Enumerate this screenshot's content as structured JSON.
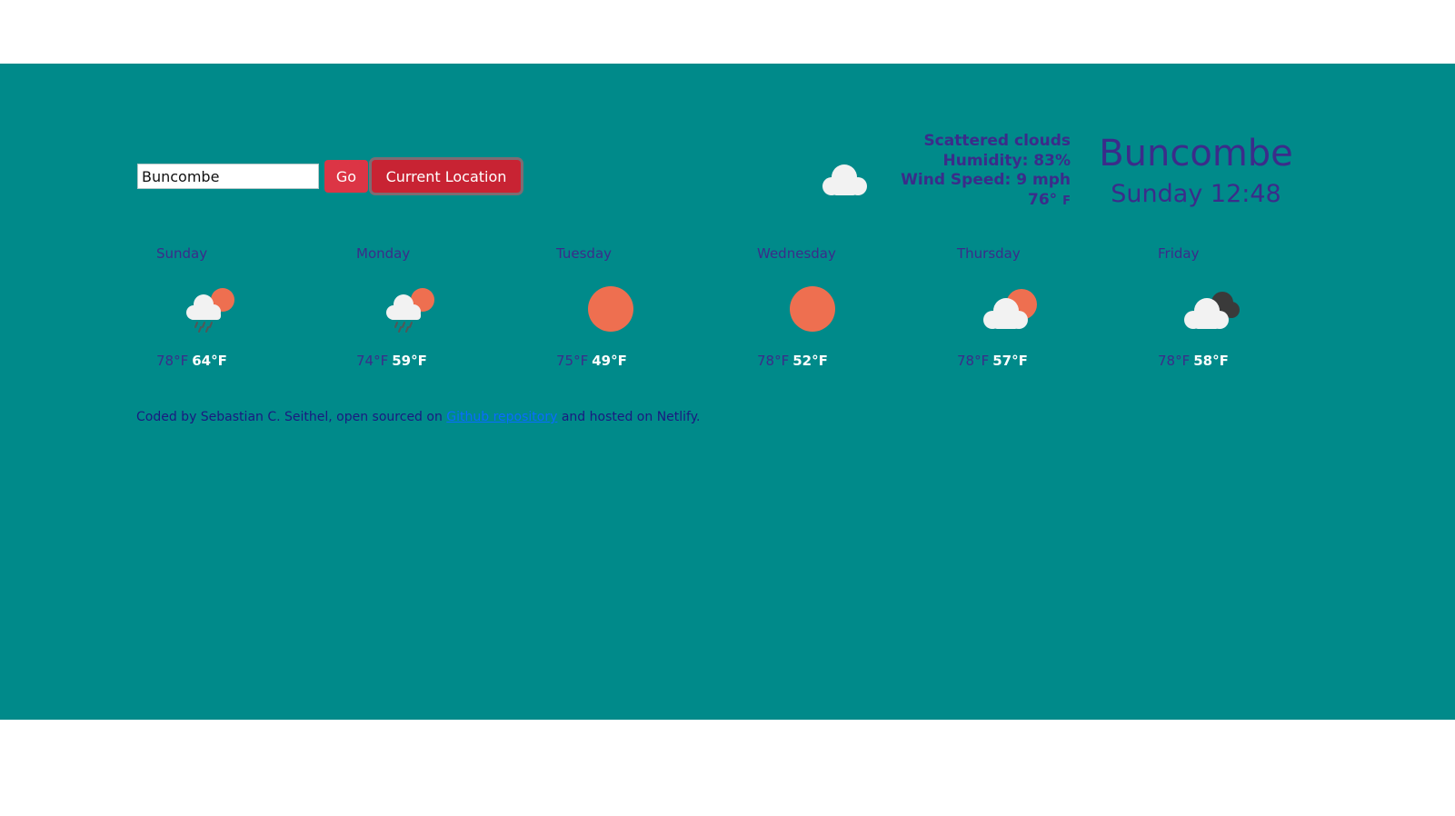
{
  "search": {
    "value": "Buncombe",
    "go_label": "Go",
    "location_label": "Current Location"
  },
  "current": {
    "icon": "cloud-icon",
    "description": "Scattered clouds",
    "humidity": "Humidity: 83%",
    "wind": "Wind Speed: 9 mph",
    "temperature": "76°",
    "unit": "F",
    "city": "Buncombe",
    "datetime": "Sunday 12:48"
  },
  "forecast": [
    {
      "day": "Sunday",
      "icon": "rain-sun-icon",
      "max": "78°F",
      "min": "64°F"
    },
    {
      "day": "Monday",
      "icon": "rain-sun-icon",
      "max": "74°F",
      "min": "59°F"
    },
    {
      "day": "Tuesday",
      "icon": "sun-icon",
      "max": "75°F",
      "min": "49°F"
    },
    {
      "day": "Wednesday",
      "icon": "sun-icon",
      "max": "78°F",
      "min": "52°F"
    },
    {
      "day": "Thursday",
      "icon": "cloud-sun-icon",
      "max": "78°F",
      "min": "57°F"
    },
    {
      "day": "Friday",
      "icon": "cloudy-icon",
      "max": "78°F",
      "min": "58°F"
    }
  ],
  "footer": {
    "prefix": "Coded by Sebastian C. Seithel, open sourced on",
    "link_text": "Github repository",
    "suffix": "and hosted on Netlify."
  },
  "colors": {
    "background": "#008a8a",
    "text": "#3b2c8a",
    "button": "#dc3545",
    "sun": "#ee6f50",
    "cloud": "#f2f2f2",
    "dark_cloud": "#3a3a3a"
  }
}
